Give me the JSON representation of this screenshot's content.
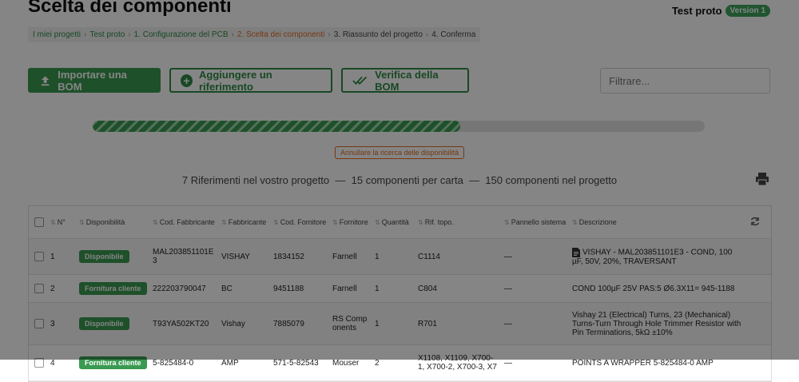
{
  "page": {
    "title": "Scelta dei componenti",
    "project_name": "Test proto",
    "version_badge": "Version 1"
  },
  "breadcrumb": [
    {
      "label": "I miei progetti",
      "state": "done"
    },
    {
      "label": "Test proto",
      "state": "done"
    },
    {
      "label": "1. Configurazione del PCB",
      "state": "done"
    },
    {
      "label": "2. Scelta dei componenti",
      "state": "active"
    },
    {
      "label": "3. Riassunto del progetto",
      "state": "todo"
    },
    {
      "label": "4. Conferma",
      "state": "todo"
    }
  ],
  "breadcrumb_sep": "›",
  "toolbar": {
    "import_label": "Importare una BOM",
    "add_label": "Aggiungere un riferimento",
    "verify_label": "Verifica della BOM",
    "filter_placeholder": "Filtrare..."
  },
  "progress": {
    "fraction": 0.6,
    "cancel_label": "Annullare la ricerca delle disponibilità"
  },
  "summary": {
    "references": "7 Riferimenti nel vostro progetto",
    "per_board": "15 componenti per carta",
    "total": "150 componenti nel progetto",
    "dash": "—"
  },
  "table": {
    "headers": {
      "n": "N°",
      "availability": "Disponibilità",
      "mfr_code": "Cod. Fabbricante",
      "manufacturer": "Fabbricante",
      "supplier_code": "Cod. Fornitore",
      "supplier": "Fornitore",
      "quantity": "Quantità",
      "ref_topo": "Rif. topo.",
      "panel": "Pannello sistema",
      "description": "Descrizione"
    },
    "rows": [
      {
        "n": "1",
        "availability": "Disponibile",
        "mfr_code": "MAL203851101E3",
        "manufacturer": "VISHAY",
        "supplier_code": "1834152",
        "supplier": "Farnell",
        "quantity": "1",
        "ref_topo": "C1114",
        "panel": "—",
        "description": "VISHAY - MAL203851101E3 - COND, 100 µF, 50V, 20%, TRAVERSANT",
        "has_doc": true
      },
      {
        "n": "2",
        "availability": "Fornitura cliente",
        "mfr_code": "222203790047",
        "manufacturer": "BC",
        "supplier_code": "9451188",
        "supplier": "Farnell",
        "quantity": "1",
        "ref_topo": "C804",
        "panel": "—",
        "description": "COND 100µF 25V PAS:5 Ø6.3X11= 945-1188",
        "has_doc": false
      },
      {
        "n": "3",
        "availability": "Disponibile",
        "mfr_code": "T93YA502KT20",
        "manufacturer": "Vishay",
        "supplier_code": "7885079",
        "supplier": "RS Components",
        "quantity": "1",
        "ref_topo": "R701",
        "panel": "—",
        "description": "Vishay 21 (Electrical) Turns, 23 (Mechanical) Turns-Turn Through Hole Trimmer Resistor with Pin Terminations, 5kΩ ±10%",
        "has_doc": false
      },
      {
        "n": "4",
        "availability": "Fornitura cliente",
        "mfr_code": "5-825484-0",
        "manufacturer": "AMP",
        "supplier_code": "571-5-82543",
        "supplier": "Mouser",
        "quantity": "2",
        "ref_topo": "X1108, X1109, X700-1, X700-2, X700-3, X7",
        "panel": "—",
        "description": "POINTS A WRAPPER 5-825484-0 AMP",
        "has_doc": false
      }
    ]
  }
}
